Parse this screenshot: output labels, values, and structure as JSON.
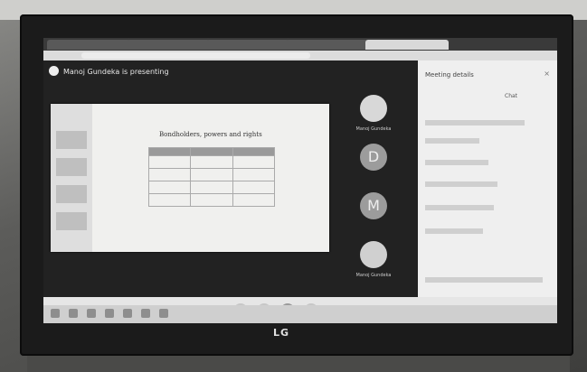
{
  "browser": {
    "tabs": [
      "",
      "",
      "",
      "",
      ""
    ],
    "address": ""
  },
  "meeting": {
    "presenter_banner": "Manoj Gundeka is presenting",
    "slide_title": "Bondholders, powers and rights",
    "participants": [
      {
        "initial": "",
        "name": "Manoj Gundeka"
      },
      {
        "initial": "D",
        "name": ""
      },
      {
        "initial": "M",
        "name": ""
      },
      {
        "initial": "",
        "name": "Manoj Gundeka"
      }
    ]
  },
  "panel": {
    "title": "Meeting details",
    "close": "×",
    "tab_people": "",
    "tab_chat": "Chat"
  },
  "monitor": {
    "brand": "LG"
  }
}
